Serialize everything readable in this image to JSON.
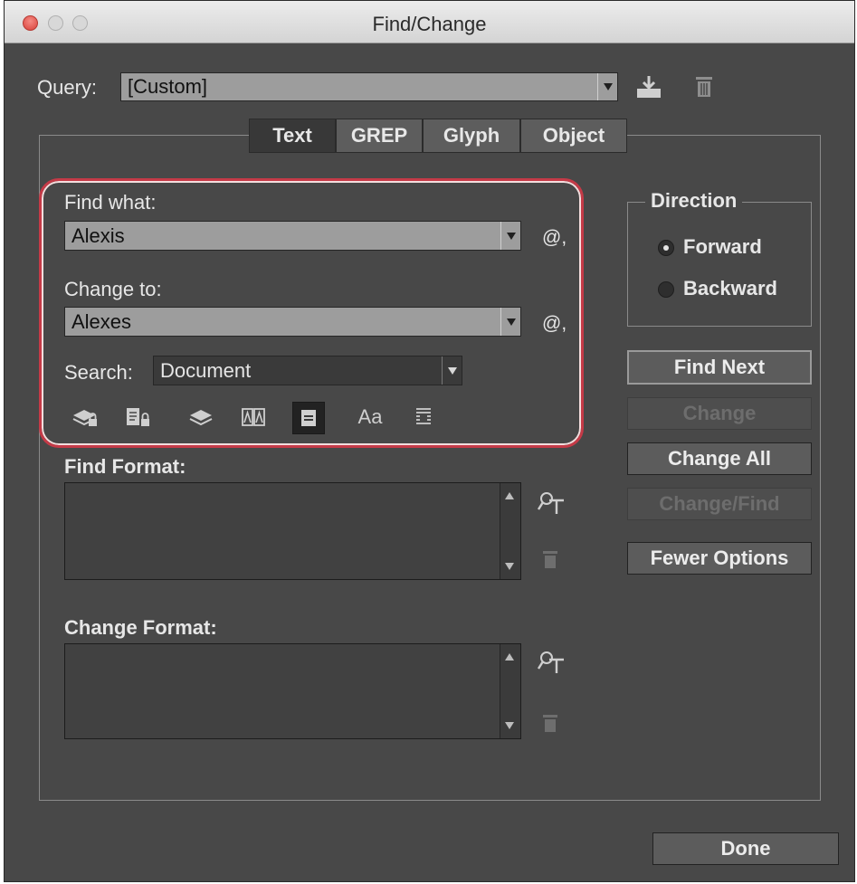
{
  "window": {
    "title": "Find/Change"
  },
  "query": {
    "label": "Query:",
    "value": "[Custom]"
  },
  "tabs": [
    "Text",
    "GREP",
    "Glyph",
    "Object"
  ],
  "find": {
    "find_label": "Find what:",
    "find_value": "Alexis",
    "change_label": "Change to:",
    "change_value": "Alexes",
    "search_label": "Search:",
    "search_value": "Document"
  },
  "formats": {
    "find_label": "Find Format:",
    "change_label": "Change Format:"
  },
  "direction": {
    "label": "Direction",
    "forward": "Forward",
    "backward": "Backward",
    "selected": "Forward"
  },
  "buttons": {
    "find_next": "Find Next",
    "change": "Change",
    "change_all": "Change All",
    "change_find": "Change/Find",
    "fewer_options": "Fewer Options",
    "done": "Done"
  },
  "toolbar_icons": [
    "locked-layers-icon",
    "locked-stories-icon",
    "hidden-layers-icon",
    "master-pages-icon",
    "footnotes-icon",
    "case-sensitive-icon",
    "whole-word-icon"
  ],
  "icons": {
    "special_char": "@,",
    "case_text": "Aa"
  },
  "colors": {
    "highlight": "#c53a47"
  }
}
